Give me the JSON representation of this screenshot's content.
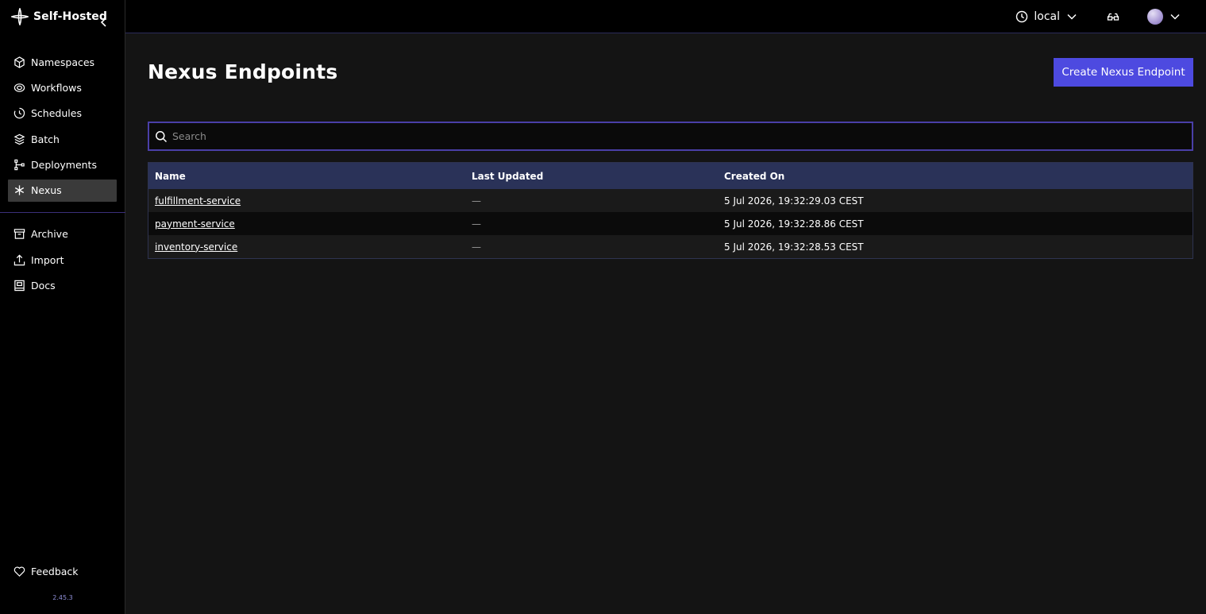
{
  "sidebar": {
    "brand": "Self-Hosted",
    "primary_items": [
      {
        "label": "Namespaces",
        "icon": "cube-icon",
        "active": false
      },
      {
        "label": "Workflows",
        "icon": "workflow-icon",
        "active": false
      },
      {
        "label": "Schedules",
        "icon": "clock-icon",
        "active": false
      },
      {
        "label": "Batch",
        "icon": "layers-icon",
        "active": false
      },
      {
        "label": "Deployments",
        "icon": "deployments-icon",
        "active": false
      },
      {
        "label": "Nexus",
        "icon": "nexus-icon",
        "active": true
      }
    ],
    "secondary_items": [
      {
        "label": "Archive",
        "icon": "archive-icon"
      },
      {
        "label": "Import",
        "icon": "upload-icon"
      },
      {
        "label": "Docs",
        "icon": "book-icon"
      }
    ],
    "feedback_label": "Feedback",
    "version": "2.45.3"
  },
  "topbar": {
    "timezone": "local"
  },
  "page": {
    "title": "Nexus Endpoints",
    "create_button": "Create Nexus Endpoint",
    "search_placeholder": "Search"
  },
  "table": {
    "columns": [
      "Name",
      "Last Updated",
      "Created On"
    ],
    "rows": [
      {
        "name": "fulfillment-service",
        "last_updated": "—",
        "created_on": "5 Jul 2026, 19:32:29.03 CEST"
      },
      {
        "name": "payment-service",
        "last_updated": "—",
        "created_on": "5 Jul 2026, 19:32:28.86 CEST"
      },
      {
        "name": "inventory-service",
        "last_updated": "—",
        "created_on": "5 Jul 2026, 19:32:28.53 CEST"
      }
    ]
  },
  "colors": {
    "accent": "#4d4ae0",
    "table_header": "#2a3258",
    "background": "#141414",
    "sidebar": "#000000"
  }
}
